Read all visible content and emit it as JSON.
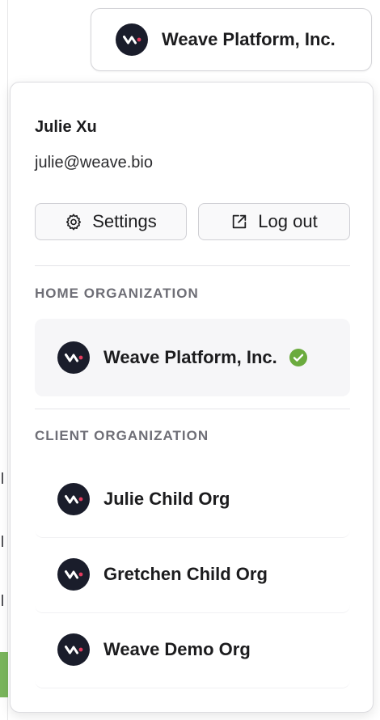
{
  "header": {
    "current_org_label": "Weave Platform, Inc.",
    "logo_icon": "weave-logo-icon"
  },
  "user": {
    "name": "Julie Xu",
    "email": "julie@weave.bio"
  },
  "actions": {
    "settings_label": "Settings",
    "settings_icon": "gear-icon",
    "logout_label": "Log out",
    "logout_icon": "external-link-icon"
  },
  "home_org": {
    "heading": "HOME ORGANIZATION",
    "items": [
      {
        "label": "Weave Platform, Inc.",
        "selected": true
      }
    ]
  },
  "client_org": {
    "heading": "CLIENT ORGANIZATION",
    "items": [
      {
        "label": "Julie Child Org"
      },
      {
        "label": "Gretchen Child Org"
      },
      {
        "label": "Weave Demo Org"
      }
    ]
  },
  "colors": {
    "logo_bg": "#1a1d2b",
    "logo_accent": "#e23b5e",
    "check_green": "#6bab3e",
    "section_text": "#6e6e76"
  }
}
